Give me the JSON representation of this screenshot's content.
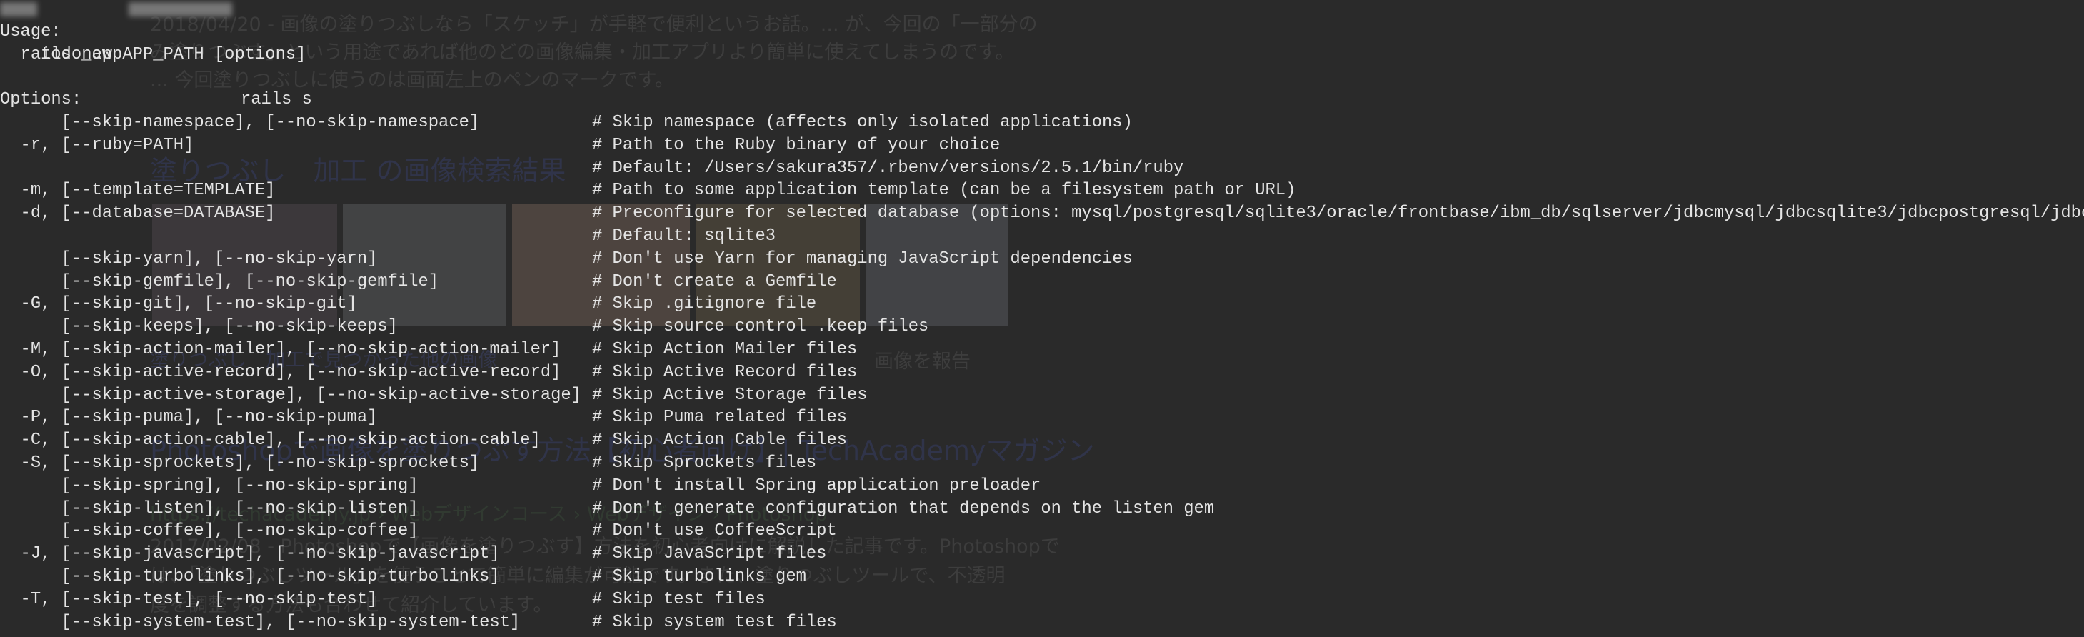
{
  "terminal": {
    "prompt": {
      "dir": "todo_app",
      "command": "rails s"
    },
    "usage_label": "Usage:",
    "usage_line": "  rails new APP_PATH [options]",
    "options_label": "Options:",
    "options": [
      {
        "opt": "      [--skip-namespace], [--no-skip-namespace]",
        "desc": "# Skip namespace (affects only isolated applications)"
      },
      {
        "opt": "  -r, [--ruby=PATH]",
        "desc": "# Path to the Ruby binary of your choice"
      },
      {
        "opt": "",
        "desc": "# Default: /Users/sakura357/.rbenv/versions/2.5.1/bin/ruby"
      },
      {
        "opt": "  -m, [--template=TEMPLATE]",
        "desc": "# Path to some application template (can be a filesystem path or URL)"
      },
      {
        "opt": "  -d, [--database=DATABASE]",
        "desc": "# Preconfigure for selected database (options: mysql/postgresql/sqlite3/oracle/frontbase/ibm_db/sqlserver/jdbcmysql/jdbcsqlite3/jdbcpostgresql/jdbc)"
      },
      {
        "opt": "",
        "desc": "# Default: sqlite3"
      },
      {
        "opt": "      [--skip-yarn], [--no-skip-yarn]",
        "desc": "# Don't use Yarn for managing JavaScript dependencies"
      },
      {
        "opt": "      [--skip-gemfile], [--no-skip-gemfile]",
        "desc": "# Don't create a Gemfile"
      },
      {
        "opt": "  -G, [--skip-git], [--no-skip-git]",
        "desc": "# Skip .gitignore file"
      },
      {
        "opt": "      [--skip-keeps], [--no-skip-keeps]",
        "desc": "# Skip source control .keep files"
      },
      {
        "opt": "  -M, [--skip-action-mailer], [--no-skip-action-mailer]",
        "desc": "# Skip Action Mailer files"
      },
      {
        "opt": "  -O, [--skip-active-record], [--no-skip-active-record]",
        "desc": "# Skip Active Record files"
      },
      {
        "opt": "      [--skip-active-storage], [--no-skip-active-storage]",
        "desc": "# Skip Active Storage files"
      },
      {
        "opt": "  -P, [--skip-puma], [--no-skip-puma]",
        "desc": "# Skip Puma related files"
      },
      {
        "opt": "  -C, [--skip-action-cable], [--no-skip-action-cable]",
        "desc": "# Skip Action Cable files"
      },
      {
        "opt": "  -S, [--skip-sprockets], [--no-skip-sprockets]",
        "desc": "# Skip Sprockets files"
      },
      {
        "opt": "      [--skip-spring], [--no-skip-spring]",
        "desc": "# Don't install Spring application preloader"
      },
      {
        "opt": "      [--skip-listen], [--no-skip-listen]",
        "desc": "# Don't generate configuration that depends on the listen gem"
      },
      {
        "opt": "      [--skip-coffee], [--no-skip-coffee]",
        "desc": "# Don't use CoffeeScript"
      },
      {
        "opt": "  -J, [--skip-javascript], [--no-skip-javascript]",
        "desc": "# Skip JavaScript files"
      },
      {
        "opt": "      [--skip-turbolinks], [--no-skip-turbolinks]",
        "desc": "# Skip turbolinks gem"
      },
      {
        "opt": "  -T, [--skip-test], [--no-skip-test]",
        "desc": "# Skip test files"
      },
      {
        "opt": "      [--skip-system-test], [--no-skip-system-test]",
        "desc": "# Skip system test files"
      }
    ]
  },
  "background_page": {
    "snippet1": [
      "2018/04/20 - 画像の塗りつぶしなら「スケッチ」が手軽で便利というお話。... が、今回の「一部分の",
      "み塗りつぶす」という用途であれば他のどの画像編集・加工アプリより簡単に使えてしまうのです。",
      "... 今回塗りつぶしに使うのは画面左上のペンのマークです。"
    ],
    "image_results_heading": "塗りつぶし　加工 の画像検索結果",
    "more_images_link": "塗りつぶし　加工で見つかった他の画像",
    "report_images": "画像を報告",
    "result_title": "Photoshopで画像を塗りつぶす方法【初心者向け】| TechAcademyマガジン",
    "result_url": "https://techacademy.jp › Webデザインコース › Webデザイン › Photoshop",
    "snippet2": [
      "2017/02/08 - Photoshopで【画像を塗りつぶす】方法を初心者向けに解説した記事です。Photoshopで",
      "は、「塗りつぶしツール」を使うことで簡単に編集が可能です。また、塗りつぶしツールで、不透明",
      "度を調整する方法も合わせて紹介しています。"
    ]
  },
  "colors": {
    "background": "#2a2a2a",
    "text": "#e4e4e4"
  }
}
